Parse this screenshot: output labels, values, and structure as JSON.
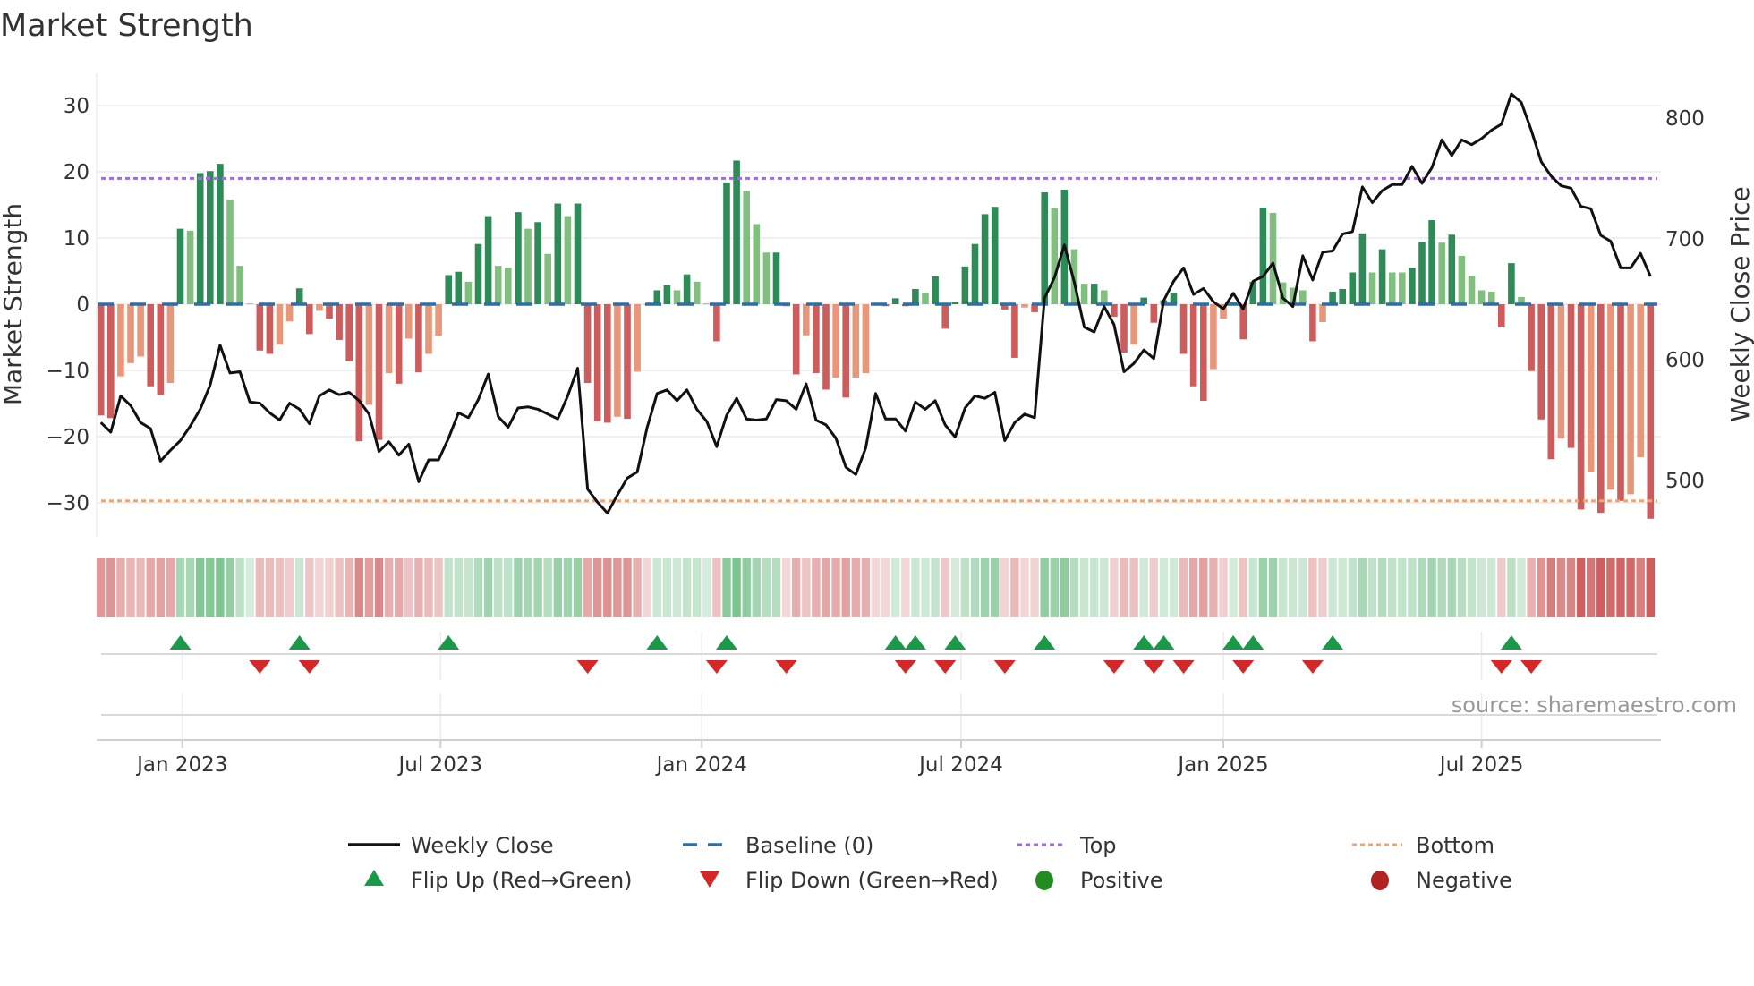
{
  "title": "Market Strength",
  "source": "source: sharemaestro.com",
  "legend": {
    "weekly_close": "Weekly Close",
    "baseline": "Baseline (0)",
    "top": "Top",
    "bottom": "Bottom",
    "flip_up": "Flip Up (Red→Green)",
    "flip_down": "Flip Down (Green→Red)",
    "positive": "Positive",
    "negative": "Negative"
  },
  "colors": {
    "strong_green": "#2e8b57",
    "weak_green": "#80bf7e",
    "strong_red": "#cd5c5c",
    "weak_red": "#e8977a",
    "baseline": "#2b6ea8",
    "top": "#a06ae0",
    "bottom": "#f0a56e",
    "price": "#111111",
    "flip_up": "#1a9a48",
    "flip_down": "#d62728",
    "positive": "#228b22",
    "negative": "#b22222"
  },
  "chart_data": {
    "type": "bar+line",
    "title": "Market Strength",
    "ylabel": "Market Strength",
    "y2label": "Weekly Close Price",
    "ylim": [
      -35,
      35
    ],
    "y2lim": [
      453,
      837
    ],
    "y_ticks": [
      "30",
      "20",
      "10",
      "0",
      "−10",
      "−20",
      "−30"
    ],
    "y_tick_values": [
      30,
      20,
      10,
      0,
      -10,
      -20,
      -30
    ],
    "y2_ticks": [
      "800",
      "700",
      "600",
      "500"
    ],
    "y2_tick_values": [
      800,
      700,
      600,
      500
    ],
    "x_ticks": [
      "Jan 2023",
      "Jul 2023",
      "Jan 2024",
      "Jul 2024",
      "Jan 2025",
      "Jul 2025"
    ],
    "x_tick_week_index": [
      8.2,
      34.2,
      60.5,
      86.6,
      113.0,
      139.0
    ],
    "baseline": 0,
    "top_level": 19.0,
    "bottom_level": -29.7,
    "strength": [
      -16.8,
      -17.2,
      -10.9,
      -8.9,
      -7.9,
      -12.4,
      -13.7,
      -11.9,
      11.4,
      11.1,
      19.8,
      20.1,
      21.2,
      15.8,
      5.8,
      0.1,
      -7.0,
      -7.5,
      -6.1,
      -2.6,
      2.4,
      -4.5,
      -1.0,
      -2.2,
      -5.4,
      -8.6,
      -20.7,
      -15.2,
      -20.5,
      -10.4,
      -12.0,
      -5.2,
      -10.3,
      -7.5,
      -4.8,
      4.4,
      4.9,
      3.4,
      9.1,
      13.3,
      5.8,
      5.5,
      13.9,
      11.4,
      12.4,
      7.6,
      15.2,
      13.3,
      15.2,
      -11.9,
      -17.7,
      -17.9,
      -17.0,
      -17.3,
      -10.2,
      -0.1,
      2.1,
      2.9,
      2.1,
      4.5,
      3.4,
      0.1,
      -5.6,
      18.4,
      21.7,
      17.1,
      12.1,
      7.8,
      7.8,
      -0.3,
      -10.6,
      -4.7,
      -10.4,
      -12.9,
      -11.1,
      -14.1,
      -11.1,
      -10.4,
      -0.2,
      -0.3,
      0.9,
      -0.3,
      2.3,
      1.7,
      4.2,
      -3.7,
      0.3,
      5.7,
      9.1,
      13.6,
      14.7,
      -0.8,
      -8.1,
      -0.5,
      -1.2,
      16.9,
      14.5,
      17.3,
      8.3,
      3.1,
      3.1,
      2.1,
      -1.9,
      -7.3,
      -6.1,
      1.0,
      -2.8,
      0.6,
      1.7,
      -7.5,
      -12.4,
      -14.6,
      -9.8,
      -2.2,
      0.3,
      -5.3,
      3.4,
      14.6,
      13.8,
      3.3,
      2.5,
      2.1,
      -5.6,
      -2.7,
      1.9,
      2.3,
      4.8,
      10.7,
      4.8,
      8.3,
      4.8,
      4.8,
      5.5,
      9.4,
      12.7,
      9.3,
      10.5,
      7.3,
      4.3,
      2.1,
      1.9,
      -3.5,
      6.2,
      1.1,
      -10.1,
      -17.4,
      -23.4,
      -20.3,
      -21.7,
      -31.0,
      -25.4,
      -31.5,
      -28.0,
      -29.7,
      -28.7,
      -23.1,
      -32.4
    ],
    "strength_shade": [
      "d",
      "d",
      "l",
      "l",
      "l",
      "d",
      "d",
      "l",
      "d",
      "l",
      "d",
      "d",
      "d",
      "l",
      "l",
      "l",
      "d",
      "d",
      "l",
      "l",
      "d",
      "d",
      "l",
      "d",
      "d",
      "d",
      "d",
      "l",
      "d",
      "l",
      "d",
      "l",
      "d",
      "l",
      "l",
      "d",
      "d",
      "l",
      "d",
      "d",
      "l",
      "l",
      "d",
      "l",
      "d",
      "l",
      "d",
      "l",
      "d",
      "d",
      "d",
      "d",
      "l",
      "d",
      "l",
      "l",
      "d",
      "d",
      "l",
      "d",
      "l",
      "l",
      "d",
      "d",
      "d",
      "l",
      "l",
      "l",
      "d",
      "d",
      "d",
      "l",
      "d",
      "d",
      "l",
      "d",
      "l",
      "l",
      "l",
      "d",
      "d",
      "d",
      "d",
      "l",
      "d",
      "d",
      "d",
      "d",
      "d",
      "d",
      "d",
      "d",
      "d",
      "l",
      "d",
      "d",
      "l",
      "d",
      "l",
      "l",
      "d",
      "l",
      "d",
      "d",
      "l",
      "d",
      "d",
      "d",
      "d",
      "d",
      "d",
      "d",
      "l",
      "l",
      "d",
      "d",
      "d",
      "d",
      "l",
      "l",
      "l",
      "l",
      "d",
      "l",
      "d",
      "d",
      "d",
      "d",
      "l",
      "d",
      "l",
      "l",
      "d",
      "d",
      "d",
      "l",
      "d",
      "l",
      "l",
      "l",
      "l",
      "d",
      "d",
      "l",
      "d",
      "d",
      "d",
      "l",
      "d",
      "d",
      "l",
      "d",
      "l",
      "d",
      "l",
      "l",
      "d"
    ],
    "weekly_close": [
      548,
      540,
      570,
      562,
      548,
      543,
      516,
      525,
      533,
      545,
      559,
      579,
      612,
      589,
      590,
      565,
      564,
      556,
      550,
      564,
      559,
      547,
      570,
      575,
      571,
      573,
      566,
      555,
      524,
      532,
      521,
      530,
      499,
      517,
      517,
      535,
      556,
      552,
      567,
      588,
      553,
      544,
      560,
      561,
      559,
      555,
      551,
      570,
      593,
      493,
      482,
      473,
      488,
      502,
      507,
      544,
      572,
      575,
      566,
      575,
      559,
      549,
      528,
      554,
      568,
      551,
      550,
      551,
      567,
      566,
      559,
      580,
      550,
      546,
      535,
      511,
      505,
      527,
      572,
      551,
      551,
      541,
      565,
      559,
      566,
      546,
      536,
      560,
      570,
      568,
      573,
      533,
      548,
      555,
      552,
      651,
      668,
      695,
      664,
      627,
      623,
      644,
      629,
      590,
      597,
      608,
      601,
      649,
      665,
      676,
      654,
      659,
      648,
      642,
      655,
      642,
      665,
      669,
      680,
      651,
      644,
      686,
      666,
      689,
      690,
      704,
      706,
      743,
      730,
      740,
      745,
      745,
      760,
      746,
      759,
      782,
      769,
      782,
      778,
      783,
      790,
      795,
      820,
      813,
      790,
      764,
      752,
      744,
      742,
      727,
      725,
      703,
      698,
      676,
      676,
      688,
      669
    ]
  }
}
